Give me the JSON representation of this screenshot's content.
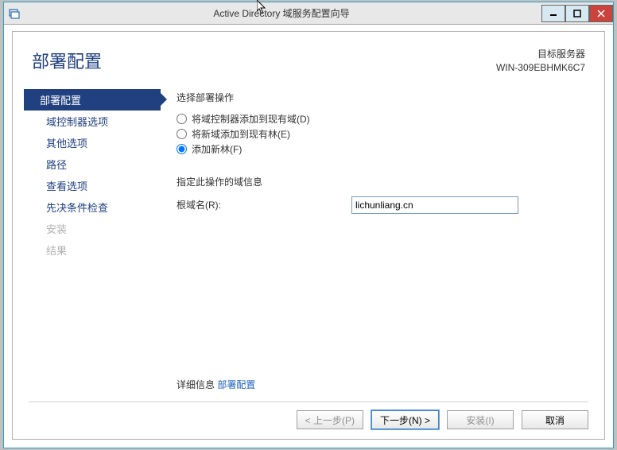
{
  "titlebar": {
    "text": "Active Directory 域服务配置向导"
  },
  "header": {
    "title": "部署配置",
    "target_label": "目标服务器",
    "target_server": "WIN-309EBHMK6C7"
  },
  "sidebar": {
    "items": [
      {
        "label": "部署配置",
        "active": true
      },
      {
        "label": "域控制器选项"
      },
      {
        "label": "其他选项"
      },
      {
        "label": "路径"
      },
      {
        "label": "查看选项"
      },
      {
        "label": "先决条件检查"
      },
      {
        "label": "安装",
        "disabled": true
      },
      {
        "label": "结果",
        "disabled": true
      }
    ]
  },
  "main": {
    "op_label": "选择部署操作",
    "radios": [
      {
        "id": "r1",
        "label": "将域控制器添加到现有域(D)"
      },
      {
        "id": "r2",
        "label": "将新域添加到现有林(E)"
      },
      {
        "id": "r3",
        "label": "添加新林(F)",
        "checked": true
      }
    ],
    "domain_section_label": "指定此操作的域信息",
    "root_domain_label": "根域名(R):",
    "root_domain_value": "lichunliang.cn",
    "more_label": "详细信息",
    "more_link": "部署配置"
  },
  "buttons": {
    "prev": "< 上一步(P)",
    "next": "下一步(N) >",
    "install": "安装(I)",
    "cancel": "取消"
  }
}
